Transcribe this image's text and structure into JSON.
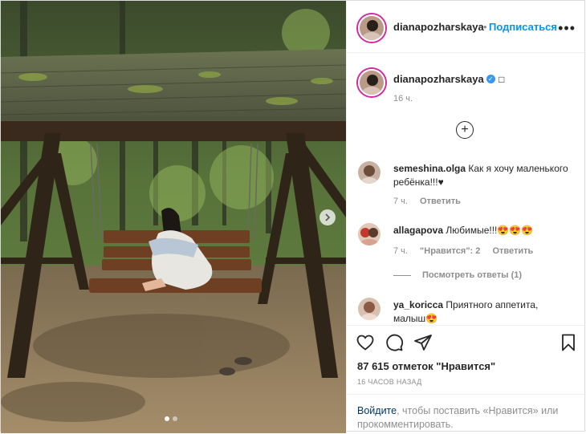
{
  "post": {
    "username": "dianapozharskaya",
    "follow_label": "Подписаться",
    "more_label": "•••",
    "caption_emoji": "□",
    "caption_time": "16 ч.",
    "add_label": "+"
  },
  "comments": [
    {
      "user": "semeshina.olga",
      "text": "Как я хочу маленького ребёнка!!!♥",
      "time": "7 ч.",
      "reply": "Ответить"
    },
    {
      "user": "allagapova",
      "text": "Любимые!!!😍😍😍",
      "time": "7 ч.",
      "likes": "\"Нравится\": 2",
      "reply": "Ответить"
    },
    {
      "user": "ya_koricca",
      "text": "Приятного аппетита, малыш😍"
    }
  ],
  "replies_label": "Посмотреть ответы (1)",
  "likes_label": "87 615 отметок \"Нравится\"",
  "post_time": "16 ЧАСОВ НАЗАД",
  "login": {
    "link": "Войдите",
    "rest": ", чтобы поставить «Нравится» или прокомментировать."
  },
  "photo": {
    "slide_count": 2,
    "active_slide": 1
  },
  "colors": {
    "accent": "#0095f6",
    "story_ring": "#d6249f"
  }
}
